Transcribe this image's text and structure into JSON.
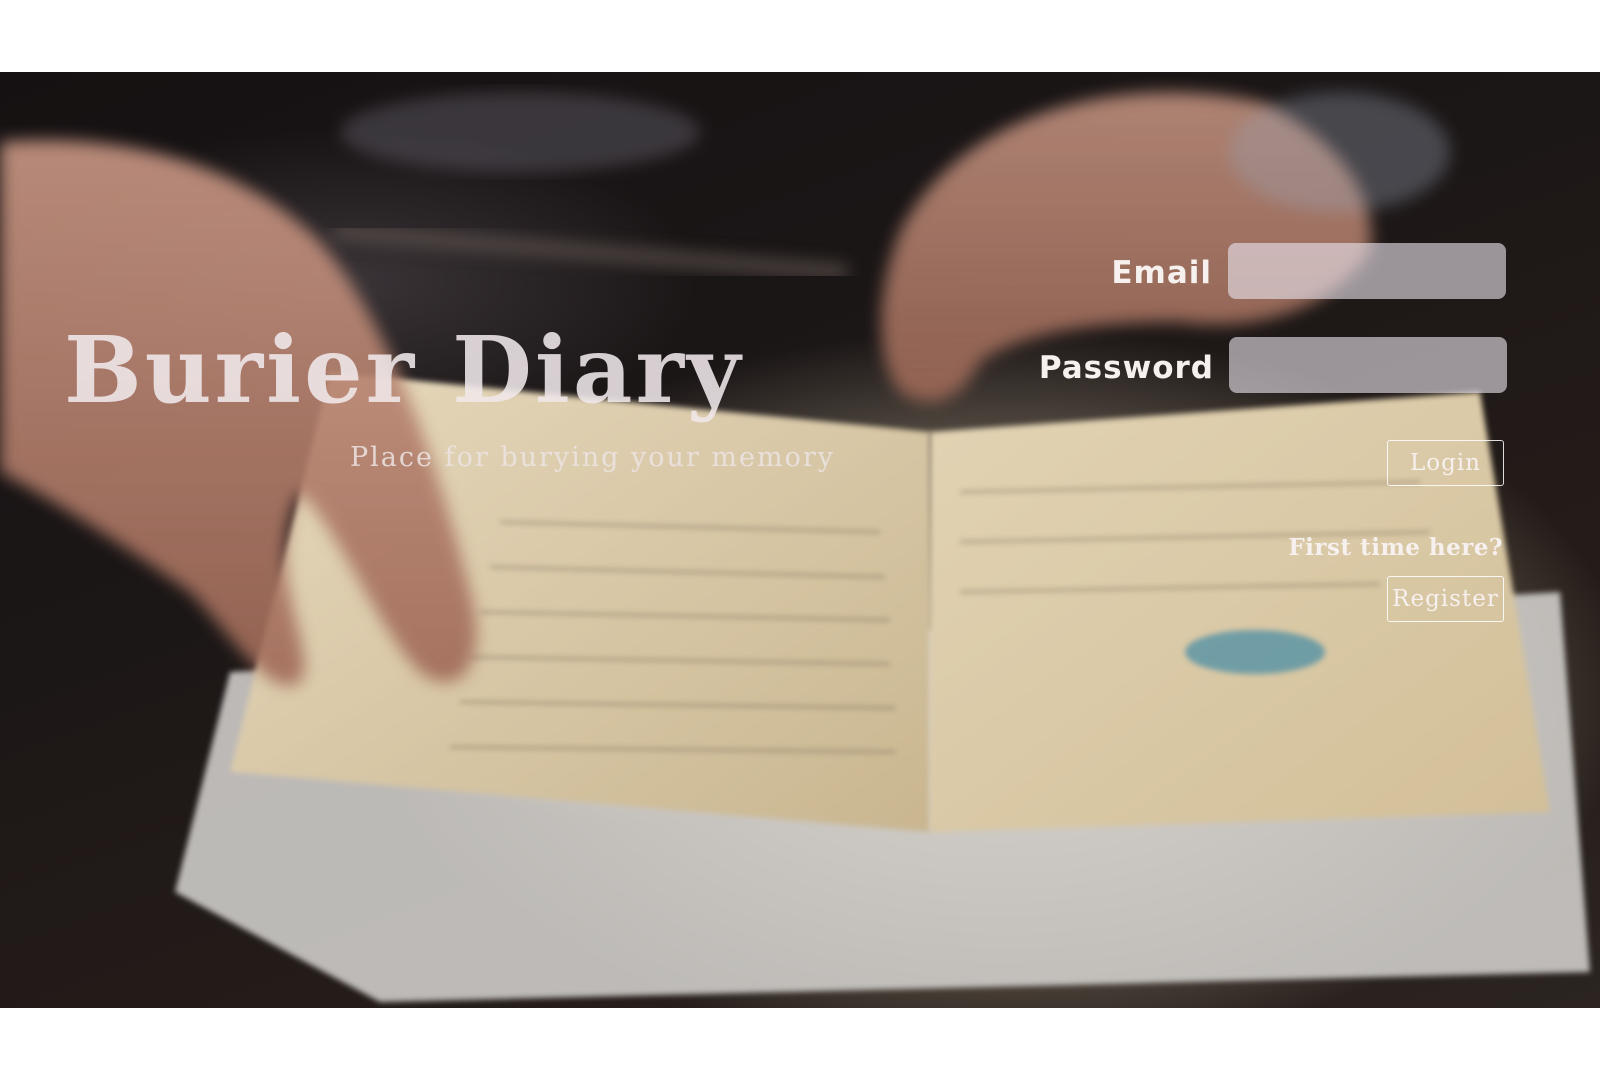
{
  "brand": {
    "title": "Burier Diary",
    "tagline": "Place for burying your memory"
  },
  "login_form": {
    "email_label": "Email",
    "email_value": "",
    "password_label": "Password",
    "password_value": "",
    "login_button": "Login"
  },
  "register": {
    "prompt": "First time here?",
    "button": "Register"
  },
  "background": {
    "subject": "hands-turning-diary-pages-photo",
    "colors": {
      "dark": "#1a1515",
      "paper": "#d6c7aa",
      "page_bg": "#ffffff"
    }
  }
}
